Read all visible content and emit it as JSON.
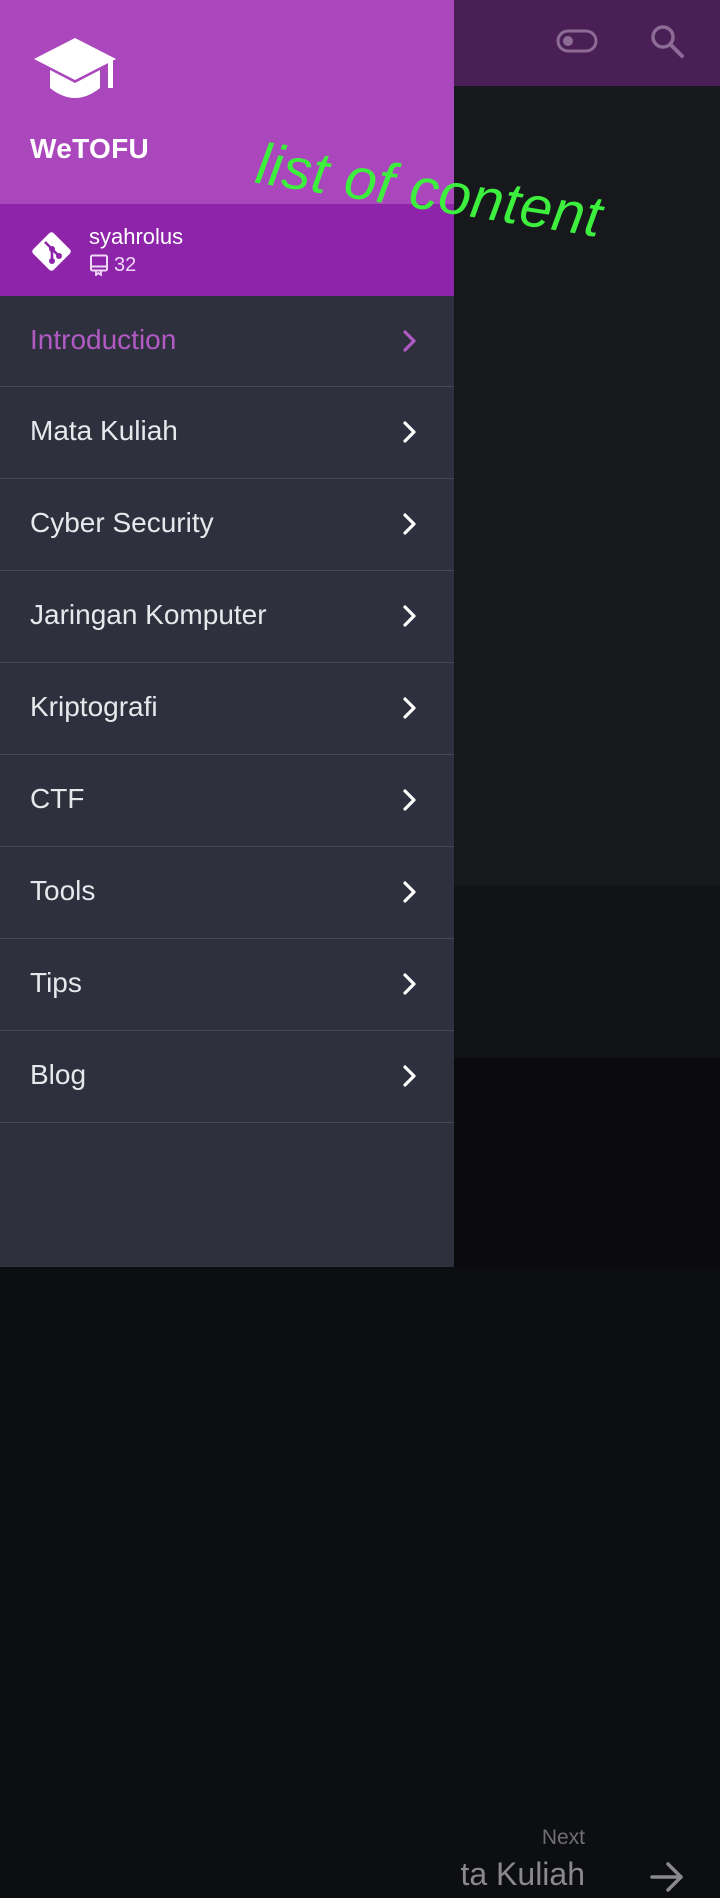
{
  "colors": {
    "drawer_header": "#ab47bc",
    "repo_bar": "#8e24aa",
    "drawer_body": "#2e303e",
    "active_item": "#b25ac4",
    "annotation": "#3ef03e",
    "app_bar": "#4a1f56"
  },
  "app_bar": {
    "toggle_icon": "toggle-switch-icon",
    "search_icon": "search-icon"
  },
  "drawer": {
    "logo_icon": "graduation-cap-icon",
    "site_name": "WeTOFU",
    "repo": {
      "icon": "git-icon",
      "owner": "syahrolus",
      "repo_count": "32"
    },
    "nav_items": [
      {
        "label": "Introduction",
        "active": true
      },
      {
        "label": "Mata Kuliah",
        "active": false
      },
      {
        "label": "Cyber Security",
        "active": false
      },
      {
        "label": "Jaringan Komputer",
        "active": false
      },
      {
        "label": "Kriptografi",
        "active": false
      },
      {
        "label": "CTF",
        "active": false
      },
      {
        "label": "Tools",
        "active": false
      },
      {
        "label": "Tips",
        "active": false
      },
      {
        "label": "Blog",
        "active": false
      }
    ]
  },
  "footer": {
    "next_caption": "Next",
    "next_title": "ta Kuliah"
  },
  "annotation": {
    "text": "list of content"
  }
}
